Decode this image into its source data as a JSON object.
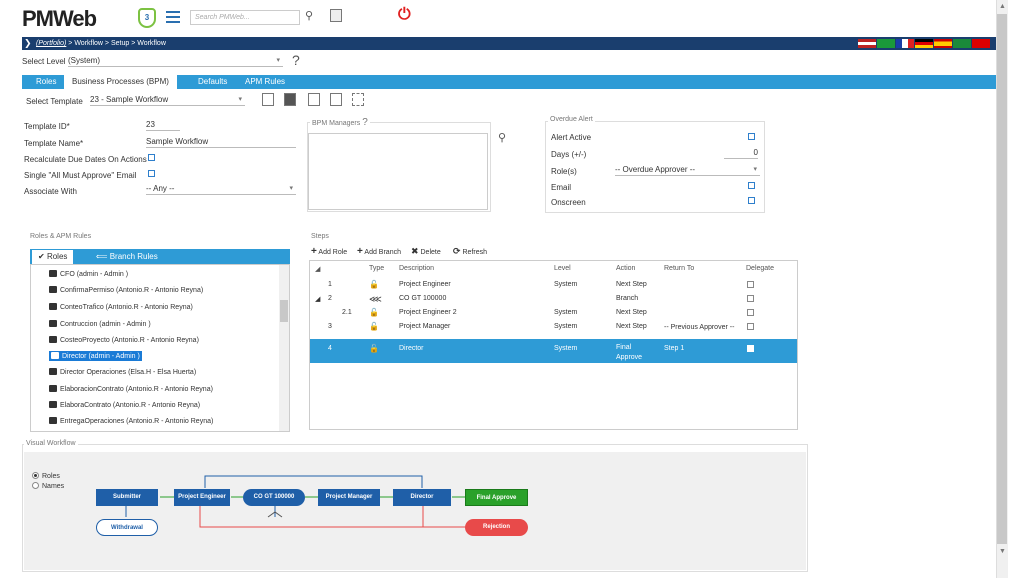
{
  "header": {
    "logo": "PMWeb",
    "badge": "3",
    "search_placeholder": "Search PMWeb...",
    "icons": [
      "hamburger-icon",
      "search-icon",
      "save-icon",
      "power-icon"
    ]
  },
  "breadcrumb": {
    "portfolio": "(Portfolio)",
    "path": " > Workflow > Setup > Workflow"
  },
  "select_level": {
    "label": "Select Level",
    "value": "(System)",
    "help": "?"
  },
  "tabs": [
    {
      "label": "Roles"
    },
    {
      "label": "Business Processes (BPM)"
    },
    {
      "label": "Defaults"
    },
    {
      "label": "APM Rules"
    }
  ],
  "template_select": {
    "label": "Select Template",
    "value": "23 - Sample Workflow"
  },
  "form": {
    "template_id_label": "Template ID*",
    "template_id": "23",
    "template_name_label": "Template Name*",
    "template_name": "Sample Workflow",
    "recalc_label": "Recalculate Due Dates On Actions",
    "single_email_label": "Single \"All Must Approve\" Email",
    "associate_label": "Associate With",
    "associate_value": "-- Any --"
  },
  "bpm_managers": {
    "title": "BPM Managers",
    "help": "?"
  },
  "overdue": {
    "title": "Overdue Alert",
    "alert_active": "Alert Active",
    "days_label": "Days (+/-)",
    "days_value": "0",
    "roles_label": "Role(s)",
    "roles_value": "-- Overdue Approver --",
    "email": "Email",
    "onscreen": "Onscreen"
  },
  "roles_panel": {
    "title": "Roles & APM Rules",
    "tab_roles": "Roles",
    "tab_branch": "Branch Rules",
    "items": [
      "CFO (admin - Admin )",
      "ConfirmaPermiso (Antonio.R - Antonio Reyna)",
      "ConteoTrafico (Antonio.R - Antonio Reyna)",
      "Contruccion (admin - Admin )",
      "CosteoProyecto (Antonio.R - Antonio Reyna)",
      "Director (admin - Admin )",
      "Director Operaciones (Elsa.H - Elsa Huerta)",
      "ElaboracionContrato (Antonio.R - Antonio Reyna)",
      "ElaboraContrato (Antonio.R - Antonio Reyna)",
      "EntregaOperaciones (Antonio.R - Antonio Reyna)"
    ]
  },
  "steps": {
    "title": "Steps",
    "add_role": "Add Role",
    "add_branch": "Add Branch",
    "delete": "Delete",
    "refresh": "Refresh",
    "columns": [
      "Type",
      "Description",
      "Level",
      "Action",
      "Return To",
      "Delegate"
    ],
    "rows": [
      {
        "num": "1",
        "description": "Project Engineer",
        "level": "System",
        "action": "Next Step",
        "return_to": ""
      },
      {
        "num": "2",
        "description": "CO GT 100000",
        "level": "",
        "action": "Branch",
        "return_to": ""
      },
      {
        "num": "2.1",
        "description": "Project Engineer 2",
        "level": "System",
        "action": "Next Step",
        "return_to": ""
      },
      {
        "num": "3",
        "description": "Project Manager",
        "level": "System",
        "action": "Next Step",
        "return_to": "-- Previous Approver --"
      },
      {
        "num": "4",
        "description": "Director",
        "level": "System",
        "action": "Final Approve",
        "return_to": "Step 1"
      }
    ]
  },
  "visual_workflow": {
    "title": "Visual Workflow",
    "radio_roles": "Roles",
    "radio_names": "Names",
    "nodes": {
      "submitter": "Submitter",
      "project_engineer": "Project Engineer",
      "co": "CO GT 100000",
      "project_manager": "Project Manager",
      "director": "Director",
      "final_approve": "Final Approve",
      "withdrawal": "Withdrawal",
      "rejection": "Rejection"
    }
  },
  "colors": {
    "tab_blue": "#2e9bd6",
    "crumb_navy": "#1a3e6e",
    "node_blue": "#1f5fa8",
    "approve_green": "#2aa12a",
    "reject_red": "#e84a4a"
  }
}
